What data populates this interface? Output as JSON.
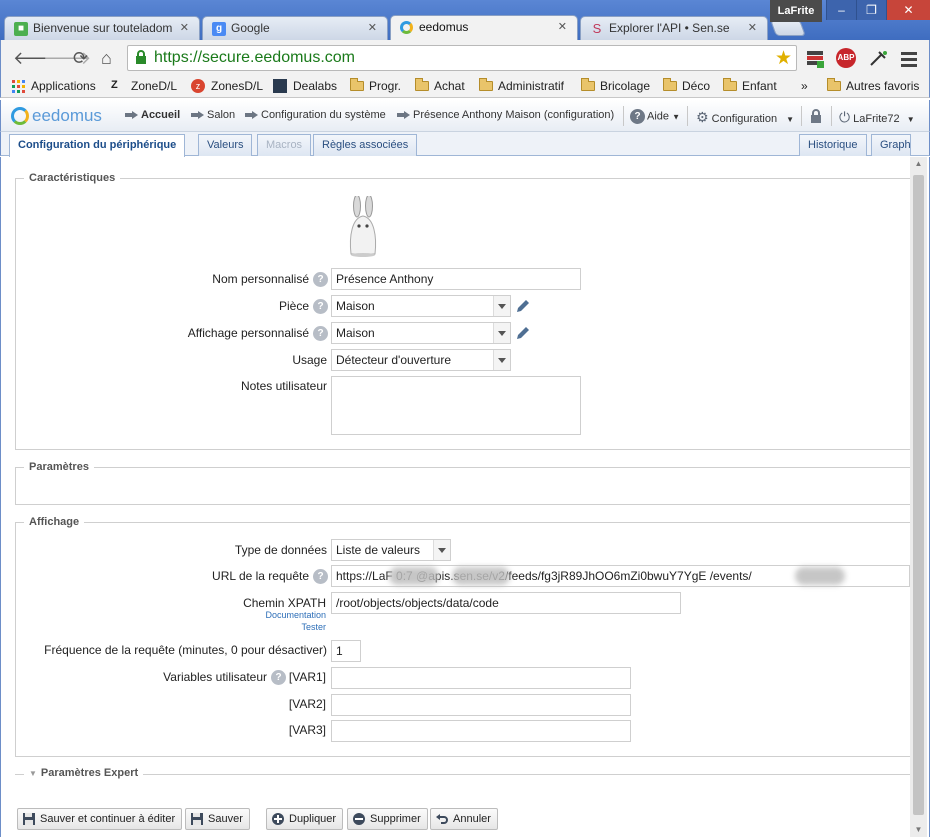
{
  "browser": {
    "tabs": [
      {
        "title": "Bienvenue sur touteladom",
        "icon": "green-square-icon"
      },
      {
        "title": "Google",
        "icon": "google-icon"
      },
      {
        "title": "eedomus",
        "icon": "eedomus-icon",
        "active": true
      },
      {
        "title": "Explorer l'API • Sen.se",
        "icon": "sense-icon"
      }
    ],
    "user_badge": "LaFrite",
    "url": "https://secure.eedomus.com"
  },
  "bookmarks": {
    "apps": "Applications",
    "items": [
      "ZoneD/L",
      "ZonesD/L",
      "Dealabs",
      "Progr.",
      "Achat",
      "Administratif",
      "Bricolage",
      "Déco",
      "Enfant"
    ],
    "overflow": "»",
    "other": "Autres favoris"
  },
  "eedomus": {
    "logo": "eedomus",
    "breadcrumb": [
      "Accueil",
      "Salon",
      "Configuration du système",
      "Présence Anthony Maison (configuration)"
    ],
    "menu": {
      "help": "Aide",
      "config": "Configuration",
      "user": "LaFrite72"
    },
    "tabs": [
      "Configuration du périphérique",
      "Valeurs",
      "Macros",
      "Règles associées"
    ],
    "right_tabs": [
      "Historique",
      "Graph"
    ]
  },
  "caracteristiques": {
    "legend": "Caractéristiques",
    "name_label": "Nom personnalisé",
    "name_value": "Présence Anthony",
    "room_label": "Pièce",
    "room_value": "Maison",
    "display_label": "Affichage personnalisé",
    "display_value": "Maison",
    "usage_label": "Usage",
    "usage_value": "Détecteur d'ouverture",
    "notes_label": "Notes utilisateur",
    "notes_value": ""
  },
  "parametres": {
    "legend": "Paramètres"
  },
  "affichage": {
    "legend": "Affichage",
    "type_label": "Type de données",
    "type_value": "Liste de valeurs",
    "url_label": "URL de la requête",
    "url_value": "https://LaF        0:7            @apis.sen.se/v2/feeds/fg3jR89JhOO6mZi0bwuY7YgE             /events/",
    "xpath_label": "Chemin XPATH",
    "xpath_doc": "Documentation",
    "xpath_test": "Tester",
    "xpath_value": "/root/objects/objects/data/code",
    "freq_label": "Fréquence de la requête (minutes, 0 pour désactiver)",
    "freq_value": "1",
    "vars_label": "Variables utilisateur",
    "var1_label": "[VAR1]",
    "var2_label": "[VAR2]",
    "var3_label": "[VAR3]",
    "var1_value": "",
    "var2_value": "",
    "var3_value": ""
  },
  "expert": {
    "legend": "Paramètres Expert"
  },
  "buttons": {
    "save_continue": "Sauver et continuer à éditer",
    "save": "Sauver",
    "duplicate": "Dupliquer",
    "delete": "Supprimer",
    "cancel": "Annuler"
  }
}
